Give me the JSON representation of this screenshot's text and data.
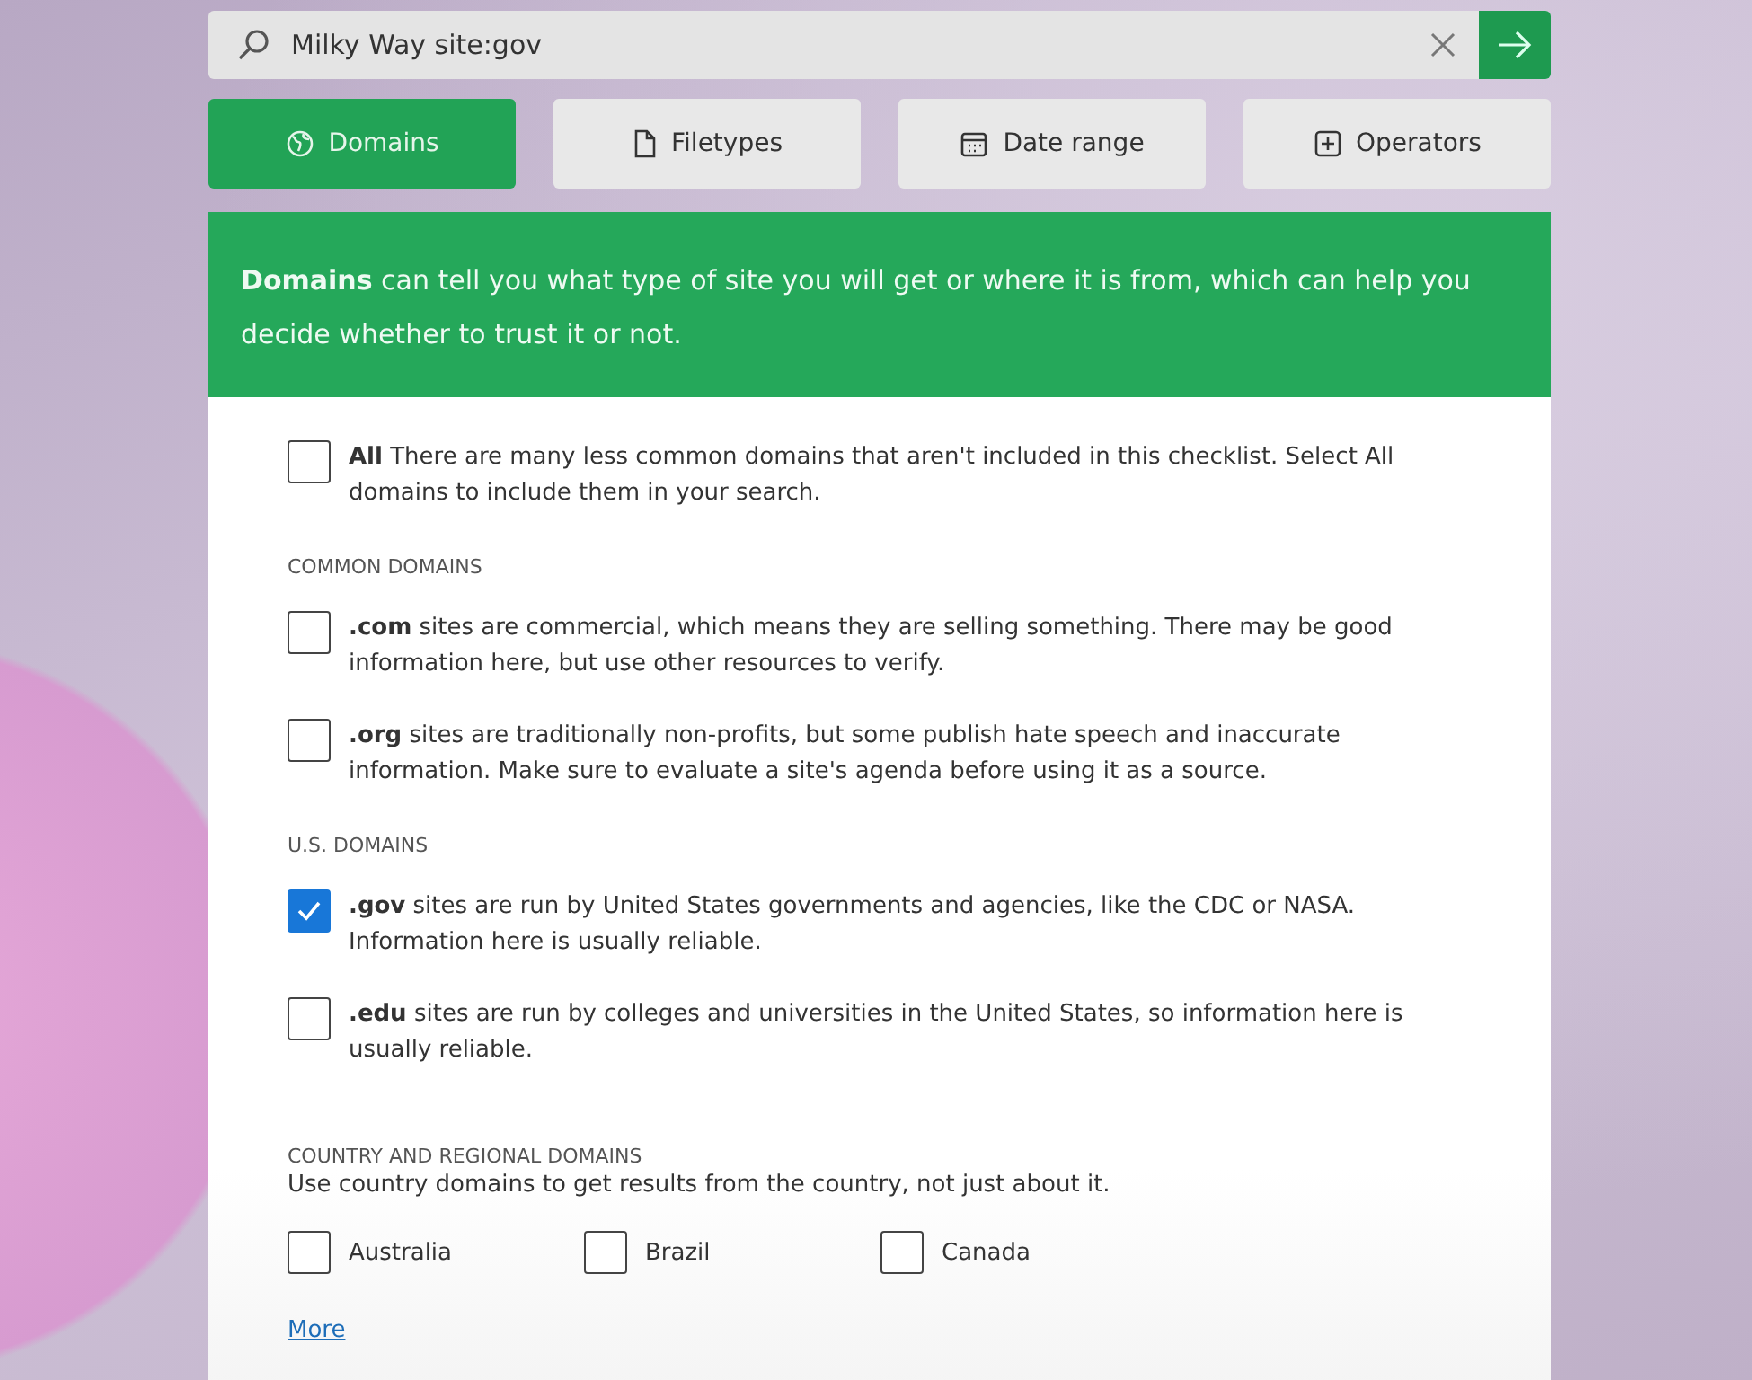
{
  "search": {
    "value": "Milky Way site:gov"
  },
  "tabs": [
    {
      "label": "Domains",
      "selected": true
    },
    {
      "label": "Filetypes",
      "selected": false
    },
    {
      "label": "Date range",
      "selected": false
    },
    {
      "label": "Operators",
      "selected": false
    }
  ],
  "intro": "**Domains**  can tell you what type of site you will get or where it is from, which can help you decide whether to trust it or not.",
  "sections": [
    {
      "kind": "list",
      "items": [
        {
          "label": "**All** There are many less common domains that aren't included in this checklist. Select All domains to include them in your search.",
          "checked": false
        }
      ]
    },
    {
      "kind": "list",
      "heading": "COMMON DOMAINS",
      "items": [
        {
          "label": "**.com** sites are commercial, which means they are selling something. There may be good information here, but use other resources to verify.",
          "checked": false
        },
        {
          "label": "**.org** sites are traditionally non-profits, but some publish hate speech and inaccurate information. Make sure to evaluate a site's agenda before using it as a source.",
          "checked": false
        }
      ]
    },
    {
      "kind": "list",
      "heading": "U.S. DOMAINS",
      "items": [
        {
          "label": "**.gov** sites are run by United States governments and agencies, like the CDC or NASA. Information here is usually reliable.",
          "checked": true
        },
        {
          "label": "**.edu** sites are run by colleges and universities in the United States, so information here is usually reliable.",
          "checked": false
        }
      ]
    },
    {
      "kind": "inline",
      "heading": "COUNTRY AND REGIONAL DOMAINS",
      "note": "Use country domains to get results from the country, not just about it.",
      "items": [
        {
          "label": "Australia",
          "checked": false
        },
        {
          "label": "Brazil",
          "checked": false
        },
        {
          "label": "Canada",
          "checked": false
        }
      ]
    }
  ],
  "more_link": "More"
}
